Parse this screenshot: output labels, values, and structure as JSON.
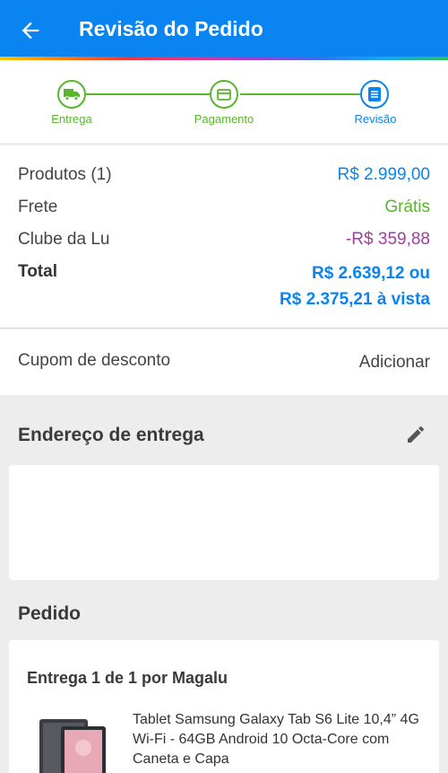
{
  "header": {
    "title": "Revisão do Pedido",
    "background": "#0a84f0"
  },
  "steps": [
    {
      "label": "Entrega",
      "icon": "truck-icon",
      "state": "done"
    },
    {
      "label": "Pagamento",
      "icon": "card-icon",
      "state": "done"
    },
    {
      "label": "Revisão",
      "icon": "list-icon",
      "state": "active"
    }
  ],
  "summary": {
    "products_label": "Produtos (1)",
    "products_value": "R$ 2.999,00",
    "shipping_label": "Frete",
    "shipping_value": "Grátis",
    "club_label": "Clube da Lu",
    "club_value": "-R$ 359,88",
    "total_label": "Total",
    "total_value_line1": "R$ 2.639,12 ou",
    "total_value_line2": "R$ 2.375,21 à vista"
  },
  "coupon": {
    "label": "Cupom de desconto",
    "action": "Adicionar"
  },
  "address": {
    "title": "Endereço de entrega"
  },
  "order": {
    "title": "Pedido",
    "seller": "Entrega 1 de 1 por Magalu",
    "product_name": "Tablet Samsung Galaxy Tab S6 Lite 10,4” 4G Wi-Fi - 64GB Android 10 Octa-Core com Caneta e Capa"
  },
  "colors": {
    "primary": "#0a84f0",
    "success": "#5ab52f",
    "club": "#9b3fa0"
  }
}
